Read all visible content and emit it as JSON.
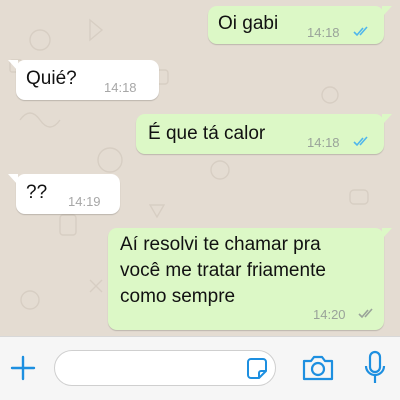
{
  "messages": [
    {
      "direction": "out",
      "text": "Oi gabi",
      "time": "14:18",
      "status": "read"
    },
    {
      "direction": "in",
      "text": "Quié?",
      "time": "14:18"
    },
    {
      "direction": "out",
      "text": "É que tá calor",
      "time": "14:18",
      "status": "read"
    },
    {
      "direction": "in",
      "text": "??",
      "time": "14:19"
    },
    {
      "direction": "out",
      "lines": [
        "Aí resolvi te chamar pra",
        "você me tratar friamente",
        "como sempre"
      ],
      "time": "14:20",
      "status": "delivered"
    }
  ],
  "input_bar": {
    "placeholder": "",
    "icons": [
      "plus-icon",
      "sticker-icon",
      "camera-icon",
      "microphone-icon"
    ]
  },
  "colors": {
    "outgoing_bubble": "#dcf8c6",
    "incoming_bubble": "#ffffff",
    "read_ticks": "#4fb6ec",
    "delivered_ticks": "#9aa39a",
    "accent": "#1d8fe0",
    "wallpaper": "#e4dcd2"
  }
}
